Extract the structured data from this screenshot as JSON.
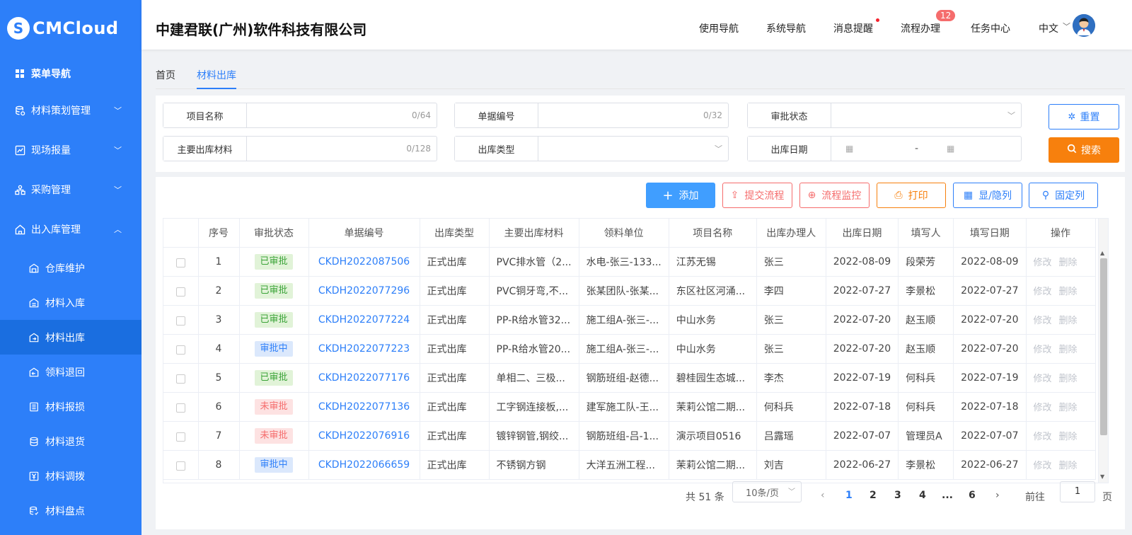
{
  "app": {
    "logo_text": "CMCloud",
    "company": "中建君联(广州)软件科技有限公司"
  },
  "header": {
    "nav": [
      "使用导航",
      "系统导航",
      "消息提醒",
      "流程办理",
      "任务中心",
      "中文"
    ],
    "process_badge": "12"
  },
  "sidebar": {
    "menu_nav": "菜单导航",
    "items": [
      {
        "label": "材料策划管理",
        "icon": "database-icon"
      },
      {
        "label": "现场报量",
        "icon": "chart-icon"
      },
      {
        "label": "采购管理",
        "icon": "org-icon"
      },
      {
        "label": "出入库管理",
        "icon": "house-icon"
      }
    ],
    "subitems": [
      {
        "label": "仓库维护",
        "icon": "warehouse-icon"
      },
      {
        "label": "材料入库",
        "icon": "inbound-icon"
      },
      {
        "label": "材料出库",
        "icon": "outbound-icon"
      },
      {
        "label": "领料退回",
        "icon": "return-icon"
      },
      {
        "label": "材料报损",
        "icon": "list-icon"
      },
      {
        "label": "材料退货",
        "icon": "cart-icon"
      },
      {
        "label": "材料调拨",
        "icon": "transfer-icon"
      },
      {
        "label": "材料盘点",
        "icon": "stock-icon"
      }
    ]
  },
  "tabs": [
    "首页",
    "材料出库"
  ],
  "filters": {
    "project_name": {
      "label": "项目名称",
      "count": "0/64"
    },
    "doc_no": {
      "label": "单据编号",
      "count": "0/32"
    },
    "approval": {
      "label": "审批状态"
    },
    "main_material": {
      "label": "主要出库材料",
      "count": "0/128"
    },
    "out_type": {
      "label": "出库类型"
    },
    "out_date": {
      "label": "出库日期",
      "sep": "-"
    },
    "reset": "重置",
    "search": "搜索"
  },
  "toolbar": {
    "add": "添加",
    "submit": "提交流程",
    "monitor": "流程监控",
    "print": "打印",
    "toggle_cols": "显/隐列",
    "fix_cols": "固定列"
  },
  "table": {
    "columns": [
      "序号",
      "审批状态",
      "单据编号",
      "出库类型",
      "主要出库材料",
      "领料单位",
      "项目名称",
      "出库办理人",
      "出库日期",
      "填写人",
      "填写日期",
      "操作"
    ],
    "actions": {
      "edit": "修改",
      "delete": "删除"
    },
    "rows": [
      {
        "no": "1",
        "status": "已审批",
        "st": "ok",
        "code": "CKDH2022087506",
        "type": "正式出库",
        "material": "PVC排水管（2...",
        "unit": "水电-张三-133...",
        "project": "江苏无锡",
        "handler": "张三",
        "date": "2022-08-09",
        "writer": "段荣芳",
        "wdate": "2022-08-09"
      },
      {
        "no": "2",
        "status": "已审批",
        "st": "ok",
        "code": "CKDH2022077296",
        "type": "正式出库",
        "material": "PVC铜牙弯,不...",
        "unit": "张某团队-张某...",
        "project": "东区社区河涌...",
        "handler": "李四",
        "date": "2022-07-27",
        "writer": "李景松",
        "wdate": "2022-07-27"
      },
      {
        "no": "3",
        "status": "已审批",
        "st": "ok",
        "code": "CKDH2022077224",
        "type": "正式出库",
        "material": "PP-R给水管32...",
        "unit": "施工组A-张三-...",
        "project": "中山水务",
        "handler": "张三",
        "date": "2022-07-20",
        "writer": "赵玉顺",
        "wdate": "2022-07-20"
      },
      {
        "no": "4",
        "status": "审批中",
        "st": "ing",
        "code": "CKDH2022077223",
        "type": "正式出库",
        "material": "PP-R给水管20...",
        "unit": "施工组A-张三-...",
        "project": "中山水务",
        "handler": "张三",
        "date": "2022-07-20",
        "writer": "赵玉顺",
        "wdate": "2022-07-20"
      },
      {
        "no": "5",
        "status": "已审批",
        "st": "ok",
        "code": "CKDH2022077176",
        "type": "正式出库",
        "material": "单相二、三极...",
        "unit": "钢筋班组-赵德...",
        "project": "碧桂园生态城...",
        "handler": "李杰",
        "date": "2022-07-19",
        "writer": "何科兵",
        "wdate": "2022-07-19"
      },
      {
        "no": "6",
        "status": "未审批",
        "st": "no",
        "code": "CKDH2022077136",
        "type": "正式出库",
        "material": "工字钢连接板,...",
        "unit": "建军施工队-王...",
        "project": "茉莉公馆二期...",
        "handler": "何科兵",
        "date": "2022-07-18",
        "writer": "何科兵",
        "wdate": "2022-07-18"
      },
      {
        "no": "7",
        "status": "未审批",
        "st": "no",
        "code": "CKDH2022076916",
        "type": "正式出库",
        "material": "镀锌钢管,钢绞...",
        "unit": "钢筋班组-吕-1...",
        "project": "演示项目0516",
        "handler": "吕露瑶",
        "date": "2022-07-07",
        "writer": "管理员A",
        "wdate": "2022-07-07"
      },
      {
        "no": "8",
        "status": "审批中",
        "st": "ing",
        "code": "CKDH2022066659",
        "type": "正式出库",
        "material": "不锈钢方钢",
        "unit": "大洋五洲工程...",
        "project": "茉莉公馆二期...",
        "handler": "刘吉",
        "date": "2022-06-27",
        "writer": "李景松",
        "wdate": "2022-06-27"
      }
    ]
  },
  "pager": {
    "total": "共 51 条",
    "page_size": "10条/页",
    "pages": [
      "1",
      "2",
      "3",
      "4",
      "...",
      "6"
    ],
    "current": "1",
    "goto_label": "前往",
    "goto_value": "1",
    "page_unit": "页"
  },
  "colors": {
    "primary": "#2d7ff9",
    "sidebar": "#2d7ff9",
    "orange": "#f7800d",
    "red": "#f56c6c"
  }
}
